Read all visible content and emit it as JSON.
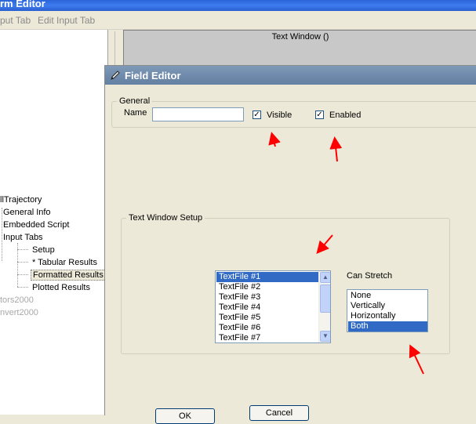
{
  "background_window": {
    "title": "rm Editor",
    "menu": [
      "put Tab",
      "Edit Input Tab"
    ],
    "preview_title": "Text Window ()"
  },
  "tree": {
    "items": [
      {
        "label": "llTrajectory",
        "grey": false
      },
      {
        "label": "General Info",
        "grey": false
      },
      {
        "label": "Embedded Script",
        "grey": false
      },
      {
        "label": "Input Tabs",
        "grey": false
      },
      {
        "label": "Setup",
        "grey": false
      },
      {
        "label": "* Tabular Results",
        "grey": false
      },
      {
        "label": "Formatted Results",
        "grey": false,
        "selected": true
      },
      {
        "label": "Plotted Results",
        "grey": false
      },
      {
        "label": "tors2000",
        "grey": true
      },
      {
        "label": "nvert2000",
        "grey": true
      }
    ]
  },
  "dialog": {
    "title": "Field Editor",
    "general": {
      "label": "General",
      "name_label": "Name",
      "name_value": "",
      "visible_label": "Visible",
      "visible_checked": true,
      "enabled_label": "Enabled",
      "enabled_checked": true
    },
    "text_window_setup": {
      "label": "Text Window Setup",
      "files": [
        "TextFile #1",
        "TextFile #2",
        "TextFile #3",
        "TextFile #4",
        "TextFile #5",
        "TextFile #6",
        "TextFile #7"
      ],
      "selected_file": "TextFile #1",
      "can_stretch_label": "Can Stretch",
      "stretch_options": [
        "None",
        "Vertically",
        "Horizontally",
        "Both"
      ],
      "selected_stretch": "Both"
    },
    "buttons": {
      "ok": "OK",
      "cancel": "Cancel"
    }
  },
  "colors": {
    "annotation_arrow": "#ff0000",
    "selection": "#316ac5",
    "dialog_title_bar": "#7a95b5"
  }
}
